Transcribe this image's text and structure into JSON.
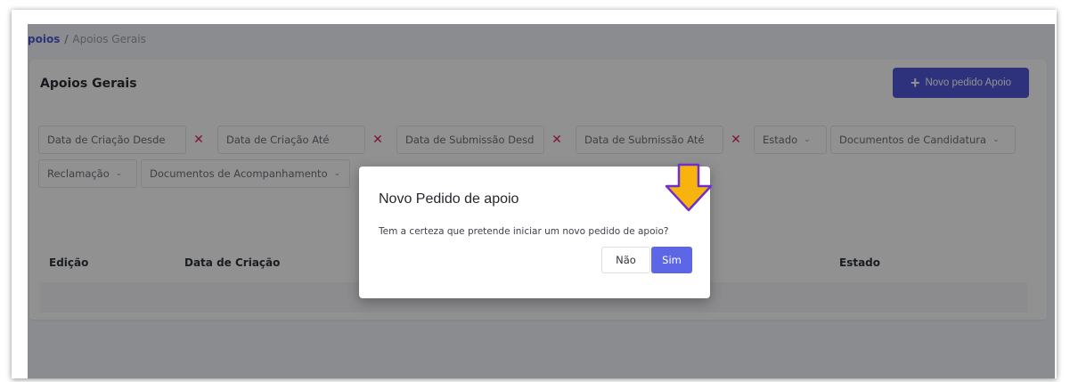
{
  "breadcrumb": {
    "parent": "poios",
    "separator": "/",
    "current": "Apoios Gerais"
  },
  "card": {
    "title": "Apoios Gerais",
    "new_button_label": "Novo pedido Apoio"
  },
  "filters": {
    "row1": [
      {
        "label": "Data de Criação Desde",
        "kind": "date"
      },
      {
        "label": "Data de Criação Até",
        "kind": "date"
      },
      {
        "label": "Data de Submissão Desd",
        "kind": "date"
      },
      {
        "label": "Data de Submissão Até",
        "kind": "date"
      },
      {
        "label": "Estado",
        "kind": "dropdown"
      },
      {
        "label": "Documentos de Candidatura",
        "kind": "dropdown"
      }
    ],
    "row2": [
      {
        "label": "Reclamação",
        "kind": "dropdown"
      },
      {
        "label": "Documentos de Acompanhamento",
        "kind": "dropdown"
      }
    ],
    "clear_glyph": "✕",
    "chevron_glyph": "⌄"
  },
  "table": {
    "columns": [
      "Edição",
      "Data de Criação",
      "Estado"
    ]
  },
  "dialog": {
    "title": "Novo Pedido de apoio",
    "message": "Tem a certeza que pretende iniciar um novo pedido de apoio?",
    "cancel_label": "Não",
    "confirm_label": "Sim"
  },
  "annotation": {
    "icon": "down-arrow-icon",
    "fill_color": "#f6b40c",
    "stroke_color": "#6f2fd0"
  },
  "colors": {
    "accent": "#5156d8",
    "confirm": "#5d66e6",
    "clear": "#e0245e"
  }
}
